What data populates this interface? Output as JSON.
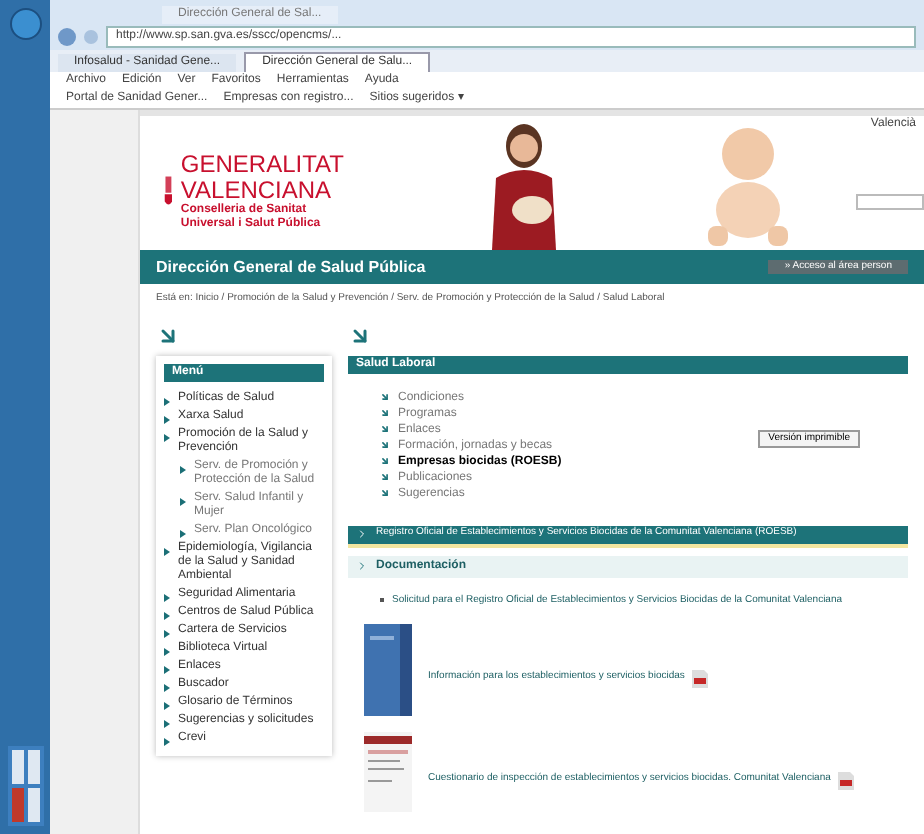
{
  "browser": {
    "window_tab": "Dirección General de Sal...",
    "address": "http://www.sp.san.gva.es/sscc/opencms/...",
    "tabs": [
      {
        "label": "Infosalud - Sanidad Gene...",
        "selected": false
      },
      {
        "label": "Dirección General de Salu...",
        "selected": true
      }
    ],
    "menu": [
      "Archivo",
      "Edición",
      "Ver",
      "Favoritos",
      "Herramientas",
      "Ayuda"
    ],
    "favorites": [
      "Portal de Sanidad Gener...",
      "Empresas con registro...",
      "Sitios sugeridos ▾"
    ]
  },
  "header": {
    "language": "Valencià",
    "logo_lines": [
      "GENERALITAT",
      "VALENCIANA"
    ],
    "logo_sub": [
      "Conselleria de Sanitat",
      "Universal i Salut Pública"
    ],
    "access": "» Acceso al área person"
  },
  "title": "Dirección General de Salud Pública",
  "breadcrumb": "Está en: Inicio / Promoción de la Salud y Prevención / Serv. de Promoción y Protección de la Salud / Salud Laboral",
  "menu": {
    "title": "Menú",
    "items": [
      {
        "label": "Políticas de Salud"
      },
      {
        "label": "Xarxa Salud"
      },
      {
        "label": "Promoción de la Salud y Prevención",
        "children": [
          {
            "label": "Serv. de Promoción y Protección de la Salud"
          },
          {
            "label": "Serv. Salud Infantil y Mujer"
          },
          {
            "label": "Serv. Plan Oncológico"
          }
        ]
      },
      {
        "label": "Epidemiología, Vigilancia de la Salud y Sanidad Ambiental"
      },
      {
        "label": "Seguridad Alimentaria"
      },
      {
        "label": "Centros de Salud Pública"
      },
      {
        "label": "Cartera de Servicios"
      },
      {
        "label": "Biblioteca Virtual"
      },
      {
        "label": "Enlaces"
      },
      {
        "label": "Buscador"
      },
      {
        "label": "Glosario de Términos"
      },
      {
        "label": "Sugerencias y solicitudes"
      },
      {
        "label": "Crevi"
      }
    ]
  },
  "section": {
    "title": "Salud Laboral",
    "links": [
      {
        "label": "Condiciones",
        "selected": false
      },
      {
        "label": "Programas",
        "selected": false
      },
      {
        "label": "Enlaces",
        "selected": false
      },
      {
        "label": "Formación, jornadas y becas",
        "selected": false
      },
      {
        "label": "Empresas biocidas (ROESB)",
        "selected": true
      },
      {
        "label": "Publicaciones",
        "selected": false
      },
      {
        "label": "Sugerencias",
        "selected": false
      }
    ],
    "print_button": "Versión imprimible"
  },
  "registry_heading": "Registro Oficial de Establecimientos y Servicios Biocidas de la Comunitat Valenciana (ROESB)",
  "documentation": {
    "heading": "Documentación",
    "bullet": "Solicitud para el Registro Oficial de Establecimientos y Servicios Biocidas de la Comunitat Valenciana",
    "documents": [
      {
        "kind": "brochure",
        "label": "Información para los establecimientos y servicios biocidas"
      },
      {
        "kind": "form",
        "label": "Cuestionario de inspección de establecimientos y servicios biocidas. Comunitat Valenciana"
      }
    ]
  }
}
